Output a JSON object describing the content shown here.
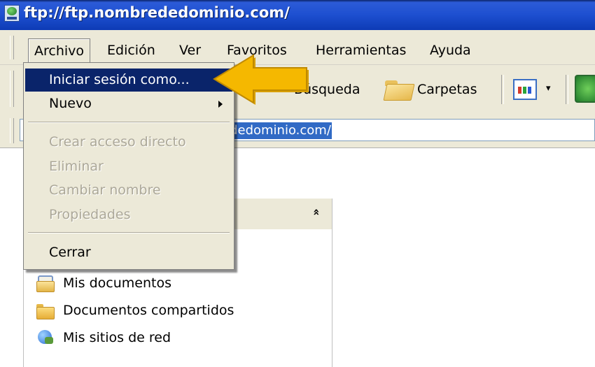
{
  "window": {
    "title": "ftp://ftp.nombrededominio.com/"
  },
  "menubar": {
    "items": [
      "Archivo",
      "Edición",
      "Ver",
      "Favoritos",
      "Herramientas",
      "Ayuda"
    ]
  },
  "toolbar": {
    "search_label": "Búsqueda",
    "folders_label": "Carpetas",
    "views_dropdown_glyph": "▾"
  },
  "address": {
    "value": "ftp://ftp.nombrededominio.com/",
    "visible_fragment": "ededominio.com/"
  },
  "file_menu": {
    "items": [
      {
        "label": "Iniciar sesión como...",
        "state": "highlighted"
      },
      {
        "label": "Nuevo",
        "state": "normal",
        "has_submenu": true
      },
      {
        "label": "Crear acceso directo",
        "state": "disabled"
      },
      {
        "label": "Eliminar",
        "state": "disabled"
      },
      {
        "label": "Cambiar nombre",
        "state": "disabled"
      },
      {
        "label": "Propiedades",
        "state": "disabled"
      },
      {
        "label": "Cerrar",
        "state": "normal"
      }
    ]
  },
  "task_pane": {
    "collapse_glyph": "❯❯",
    "places": [
      {
        "label": "Mis documentos",
        "icon": "my-documents-icon"
      },
      {
        "label": "Documentos compartidos",
        "icon": "shared-documents-icon"
      },
      {
        "label": "Mis sitios de red",
        "icon": "network-places-icon"
      }
    ]
  },
  "colors": {
    "titlebar": "#1d4fd0",
    "menu_highlight": "#0a246a",
    "address_selection": "#316ac5",
    "pointer_arrow": "#f5b800"
  }
}
